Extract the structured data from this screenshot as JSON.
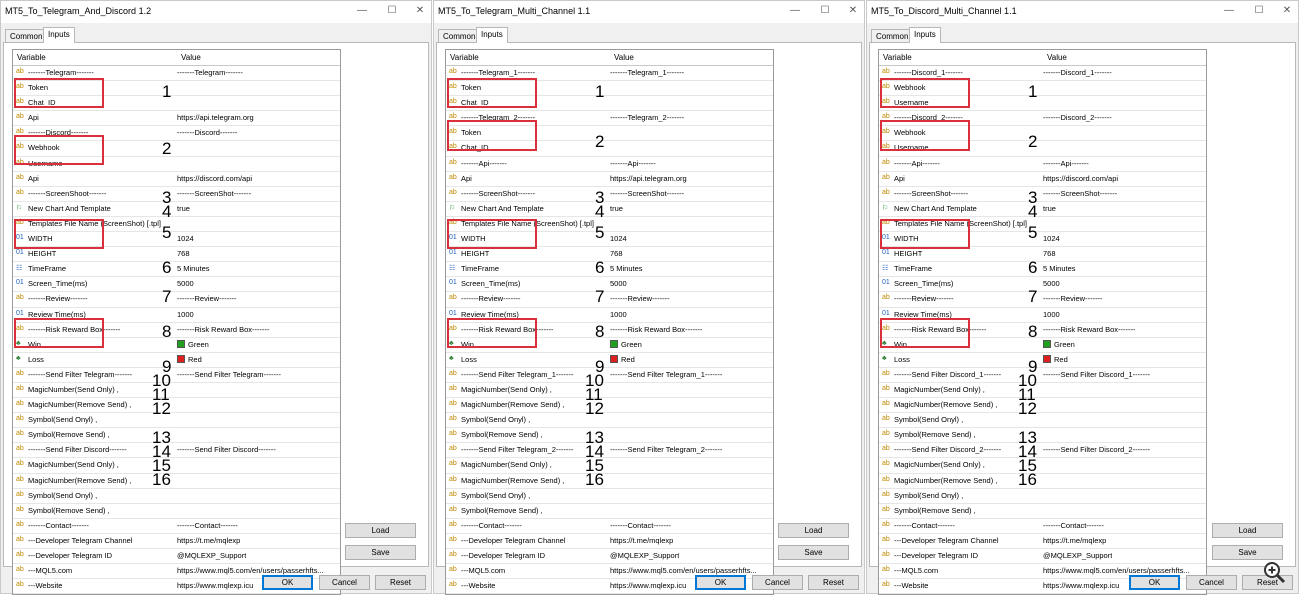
{
  "dialogs": [
    {
      "title": "MT5_To_Telegram_And_Discord 1.2",
      "tabs": [
        "Common",
        "Inputs"
      ],
      "active_tab": "Inputs",
      "columns": [
        "Variable",
        "Value"
      ],
      "rows": [
        {
          "icon": "ab",
          "name": "-------Telegram-------",
          "value": "-------Telegram-------"
        },
        {
          "icon": "ab",
          "name": "Token",
          "value": ""
        },
        {
          "icon": "ab",
          "name": "Chat_ID",
          "value": ""
        },
        {
          "icon": "ab",
          "name": "Api",
          "value": "https://api.telegram.org"
        },
        {
          "icon": "ab",
          "name": "-------Discord-------",
          "value": "-------Discord-------"
        },
        {
          "icon": "ab",
          "name": "Webhook",
          "value": ""
        },
        {
          "icon": "ab",
          "name": "Username",
          "value": ""
        },
        {
          "icon": "ab",
          "name": "Api",
          "value": "https://discord.com/api"
        },
        {
          "icon": "ab",
          "name": "-------ScreenShoot-------",
          "value": "-------ScreenShot-------"
        },
        {
          "icon": "bool",
          "name": "New Chart And Template",
          "value": "true"
        },
        {
          "icon": "ab",
          "name": "Templates File Name (ScreenShot) [.tpl]",
          "value": ""
        },
        {
          "icon": "01",
          "name": "WIDTH",
          "value": "1024"
        },
        {
          "icon": "01",
          "name": "HEIGHT",
          "value": "768"
        },
        {
          "icon": "tf",
          "name": "TimeFrame",
          "value": "5 Minutes"
        },
        {
          "icon": "01",
          "name": "Screen_Time(ms)",
          "value": "5000"
        },
        {
          "icon": "ab",
          "name": "-------Review-------",
          "value": "-------Review-------"
        },
        {
          "icon": "01",
          "name": "Review Time(ms)",
          "value": "1000"
        },
        {
          "icon": "ab",
          "name": "-------Risk Reward Box-------",
          "value": "-------Risk Reward Box-------"
        },
        {
          "icon": "clr",
          "name": "Win",
          "value": "Green",
          "color": "#1f9e1f"
        },
        {
          "icon": "clr",
          "name": "Loss",
          "value": "Red",
          "color": "#e0201e"
        },
        {
          "icon": "ab",
          "name": "-------Send Filter Telegram-------",
          "value": "-------Send Filter Telegram-------"
        },
        {
          "icon": "ab",
          "name": "MagicNumber(Send Only) ,",
          "value": ""
        },
        {
          "icon": "ab",
          "name": "MagicNumber(Remove Send) ,",
          "value": ""
        },
        {
          "icon": "ab",
          "name": "Symbol(Send Onyl) ,",
          "value": ""
        },
        {
          "icon": "ab",
          "name": "Symbol(Remove Send) ,",
          "value": ""
        },
        {
          "icon": "ab",
          "name": "-------Send Filter Discord-------",
          "value": "-------Send Filter Discord-------"
        },
        {
          "icon": "ab",
          "name": "MagicNumber(Send Only) ,",
          "value": ""
        },
        {
          "icon": "ab",
          "name": "MagicNumber(Remove Send) ,",
          "value": ""
        },
        {
          "icon": "ab",
          "name": "Symbol(Send Onyl) ,",
          "value": ""
        },
        {
          "icon": "ab",
          "name": "Symbol(Remove Send) ,",
          "value": ""
        },
        {
          "icon": "ab",
          "name": "-------Contact-------",
          "value": "-------Contact-------"
        },
        {
          "icon": "ab",
          "name": "---Developer Telegram Channel",
          "value": "https://t.me/mqlexp"
        },
        {
          "icon": "ab",
          "name": "---Developer Telegram ID",
          "value": "@MQLEXP_Support"
        },
        {
          "icon": "ab",
          "name": "---MQL5.com",
          "value": "https://www.mql5.com/en/users/passerhfts..."
        },
        {
          "icon": "ab",
          "name": "---Website",
          "value": "https://www.mqlexp.icu"
        }
      ],
      "annotations": [
        {
          "label": "1",
          "row": 1.5
        },
        {
          "label": "2",
          "row": 5.5
        },
        {
          "label": "3",
          "row": 9
        },
        {
          "label": "4",
          "row": 10
        },
        {
          "label": "5",
          "row": 11.5
        },
        {
          "label": "6",
          "row": 14
        },
        {
          "label": "7",
          "row": 16
        },
        {
          "label": "8",
          "row": 18.5
        },
        {
          "label": "9",
          "row": 21
        },
        {
          "label": "10",
          "row": 22
        },
        {
          "label": "11",
          "row": 23
        },
        {
          "label": "12",
          "row": 24
        },
        {
          "label": "13",
          "row": 26
        },
        {
          "label": "14",
          "row": 27
        },
        {
          "label": "15",
          "row": 28
        },
        {
          "label": "16",
          "row": 29
        }
      ],
      "boxes": [
        [
          1,
          2
        ],
        [
          5,
          6
        ],
        [
          11,
          12
        ],
        [
          18,
          19
        ]
      ],
      "side_buttons": {
        "load": "Load",
        "save": "Save"
      },
      "footer": {
        "ok": "OK",
        "cancel": "Cancel",
        "reset": "Reset"
      }
    },
    {
      "title": "MT5_To_Telegram_Multi_Channel 1.1",
      "tabs": [
        "Common",
        "Inputs"
      ],
      "active_tab": "Inputs",
      "columns": [
        "Variable",
        "Value"
      ],
      "rows": [
        {
          "icon": "ab",
          "name": "-------Telegram_1-------",
          "value": "-------Telegram_1-------"
        },
        {
          "icon": "ab",
          "name": "Token",
          "value": ""
        },
        {
          "icon": "ab",
          "name": "Chat_ID",
          "value": ""
        },
        {
          "icon": "ab",
          "name": "-------Telegram_2-------",
          "value": "-------Telegram_2-------"
        },
        {
          "icon": "ab",
          "name": "Token",
          "value": ""
        },
        {
          "icon": "ab",
          "name": "Chat_ID",
          "value": ""
        },
        {
          "icon": "ab",
          "name": "-------Api-------",
          "value": "-------Api-------"
        },
        {
          "icon": "ab",
          "name": "Api",
          "value": "https://api.telegram.org"
        },
        {
          "icon": "ab",
          "name": "-------ScreenShot-------",
          "value": "-------ScreenShot-------"
        },
        {
          "icon": "bool",
          "name": "New Chart And Template",
          "value": "true"
        },
        {
          "icon": "ab",
          "name": "Templates File Name (ScreenShot) [.tpl]",
          "value": ""
        },
        {
          "icon": "01",
          "name": "WIDTH",
          "value": "1024"
        },
        {
          "icon": "01",
          "name": "HEIGHT",
          "value": "768"
        },
        {
          "icon": "tf",
          "name": "TimeFrame",
          "value": "5 Minutes"
        },
        {
          "icon": "01",
          "name": "Screen_Time(ms)",
          "value": "5000"
        },
        {
          "icon": "ab",
          "name": "-------Review-------",
          "value": "-------Review-------"
        },
        {
          "icon": "01",
          "name": "Review Time(ms)",
          "value": "1000"
        },
        {
          "icon": "ab",
          "name": "-------Risk Reward Box-------",
          "value": "-------Risk Reward Box-------"
        },
        {
          "icon": "clr",
          "name": "Win",
          "value": "Green",
          "color": "#1f9e1f"
        },
        {
          "icon": "clr",
          "name": "Loss",
          "value": "Red",
          "color": "#e0201e"
        },
        {
          "icon": "ab",
          "name": "-------Send Filter Telegram_1-------",
          "value": "-------Send Filter Telegram_1-------"
        },
        {
          "icon": "ab",
          "name": "MagicNumber(Send Only) ,",
          "value": ""
        },
        {
          "icon": "ab",
          "name": "MagicNumber(Remove Send) ,",
          "value": ""
        },
        {
          "icon": "ab",
          "name": "Symbol(Send Onyl) ,",
          "value": ""
        },
        {
          "icon": "ab",
          "name": "Symbol(Remove Send) ,",
          "value": ""
        },
        {
          "icon": "ab",
          "name": "-------Send Filter Telegram_2-------",
          "value": "-------Send Filter Telegram_2-------"
        },
        {
          "icon": "ab",
          "name": "MagicNumber(Send Only) ,",
          "value": ""
        },
        {
          "icon": "ab",
          "name": "MagicNumber(Remove Send) ,",
          "value": ""
        },
        {
          "icon": "ab",
          "name": "Symbol(Send Onyl) ,",
          "value": ""
        },
        {
          "icon": "ab",
          "name": "Symbol(Remove Send) ,",
          "value": ""
        },
        {
          "icon": "ab",
          "name": "-------Contact-------",
          "value": "-------Contact-------"
        },
        {
          "icon": "ab",
          "name": "---Developer Telegram Channel",
          "value": "https://t.me/mqlexp"
        },
        {
          "icon": "ab",
          "name": "---Developer Telegram ID",
          "value": "@MQLEXP_Support"
        },
        {
          "icon": "ab",
          "name": "---MQL5.com",
          "value": "https://www.mql5.com/en/users/passerhfts..."
        },
        {
          "icon": "ab",
          "name": "---Website",
          "value": "https://www.mqlexp.icu"
        }
      ],
      "annotations": [
        {
          "label": "1",
          "row": 1.5
        },
        {
          "label": "2",
          "row": 5
        },
        {
          "label": "3",
          "row": 9
        },
        {
          "label": "4",
          "row": 10
        },
        {
          "label": "5",
          "row": 11.5
        },
        {
          "label": "6",
          "row": 14
        },
        {
          "label": "7",
          "row": 16
        },
        {
          "label": "8",
          "row": 18.5
        },
        {
          "label": "9",
          "row": 21
        },
        {
          "label": "10",
          "row": 22
        },
        {
          "label": "11",
          "row": 23
        },
        {
          "label": "12",
          "row": 24
        },
        {
          "label": "13",
          "row": 26
        },
        {
          "label": "14",
          "row": 27
        },
        {
          "label": "15",
          "row": 28
        },
        {
          "label": "16",
          "row": 29
        }
      ],
      "boxes": [
        [
          1,
          2
        ],
        [
          4,
          5
        ],
        [
          11,
          12
        ],
        [
          18,
          19
        ]
      ],
      "side_buttons": {
        "load": "Load",
        "save": "Save"
      },
      "footer": {
        "ok": "OK",
        "cancel": "Cancel",
        "reset": "Reset"
      }
    },
    {
      "title": "MT5_To_Discord_Multi_Channel 1.1",
      "tabs": [
        "Common",
        "Inputs"
      ],
      "active_tab": "Inputs",
      "columns": [
        "Variable",
        "Value"
      ],
      "rows": [
        {
          "icon": "ab",
          "name": "-------Discord_1-------",
          "value": "-------Discord_1-------"
        },
        {
          "icon": "ab",
          "name": "Webhook",
          "value": ""
        },
        {
          "icon": "ab",
          "name": "Username",
          "value": ""
        },
        {
          "icon": "ab",
          "name": "-------Discord_2-------",
          "value": "-------Discord_2-------"
        },
        {
          "icon": "ab",
          "name": "Webhook",
          "value": ""
        },
        {
          "icon": "ab",
          "name": "Username",
          "value": ""
        },
        {
          "icon": "ab",
          "name": "-------Api-------",
          "value": "-------Api-------"
        },
        {
          "icon": "ab",
          "name": "Api",
          "value": "https://discord.com/api"
        },
        {
          "icon": "ab",
          "name": "-------ScreenShot-------",
          "value": "-------ScreenShot-------"
        },
        {
          "icon": "bool",
          "name": "New Chart And Template",
          "value": "true"
        },
        {
          "icon": "ab",
          "name": "Templates File Name (ScreenShot) [.tpl]",
          "value": ""
        },
        {
          "icon": "01",
          "name": "WIDTH",
          "value": "1024"
        },
        {
          "icon": "01",
          "name": "HEIGHT",
          "value": "768"
        },
        {
          "icon": "tf",
          "name": "TimeFrame",
          "value": "5 Minutes"
        },
        {
          "icon": "01",
          "name": "Screen_Time(ms)",
          "value": "5000"
        },
        {
          "icon": "ab",
          "name": "-------Review-------",
          "value": "-------Review-------"
        },
        {
          "icon": "01",
          "name": "Review Time(ms)",
          "value": "1000"
        },
        {
          "icon": "ab",
          "name": "-------Risk Reward Box-------",
          "value": "-------Risk Reward Box-------"
        },
        {
          "icon": "clr",
          "name": "Win",
          "value": "Green",
          "color": "#1f9e1f"
        },
        {
          "icon": "clr",
          "name": "Loss",
          "value": "Red",
          "color": "#e0201e"
        },
        {
          "icon": "ab",
          "name": "-------Send Filter Discord_1-------",
          "value": "-------Send Filter Discord_1-------"
        },
        {
          "icon": "ab",
          "name": "MagicNumber(Send Only) ,",
          "value": ""
        },
        {
          "icon": "ab",
          "name": "MagicNumber(Remove Send) ,",
          "value": ""
        },
        {
          "icon": "ab",
          "name": "Symbol(Send Onyl) ,",
          "value": ""
        },
        {
          "icon": "ab",
          "name": "Symbol(Remove Send) ,",
          "value": ""
        },
        {
          "icon": "ab",
          "name": "-------Send Filter Discord_2-------",
          "value": "-------Send Filter Discord_2-------"
        },
        {
          "icon": "ab",
          "name": "MagicNumber(Send Only) ,",
          "value": ""
        },
        {
          "icon": "ab",
          "name": "MagicNumber(Remove Send) ,",
          "value": ""
        },
        {
          "icon": "ab",
          "name": "Symbol(Send Onyl) ,",
          "value": ""
        },
        {
          "icon": "ab",
          "name": "Symbol(Remove Send) ,",
          "value": ""
        },
        {
          "icon": "ab",
          "name": "-------Contact-------",
          "value": "-------Contact-------"
        },
        {
          "icon": "ab",
          "name": "---Developer Telegram Channel",
          "value": "https://t.me/mqlexp"
        },
        {
          "icon": "ab",
          "name": "---Developer Telegram ID",
          "value": "@MQLEXP_Support"
        },
        {
          "icon": "ab",
          "name": "---MQL5.com",
          "value": "https://www.mql5.com/en/users/passerhfts..."
        },
        {
          "icon": "ab",
          "name": "---Website",
          "value": "https://www.mqlexp.icu"
        }
      ],
      "annotations": [
        {
          "label": "1",
          "row": 1.5
        },
        {
          "label": "2",
          "row": 5
        },
        {
          "label": "3",
          "row": 9
        },
        {
          "label": "4",
          "row": 10
        },
        {
          "label": "5",
          "row": 11.5
        },
        {
          "label": "6",
          "row": 14
        },
        {
          "label": "7",
          "row": 16
        },
        {
          "label": "8",
          "row": 18.5
        },
        {
          "label": "9",
          "row": 21
        },
        {
          "label": "10",
          "row": 22
        },
        {
          "label": "11",
          "row": 23
        },
        {
          "label": "12",
          "row": 24
        },
        {
          "label": "13",
          "row": 26
        },
        {
          "label": "14",
          "row": 27
        },
        {
          "label": "15",
          "row": 28
        },
        {
          "label": "16",
          "row": 29
        }
      ],
      "boxes": [
        [
          1,
          2
        ],
        [
          4,
          5
        ],
        [
          11,
          12
        ],
        [
          18,
          19
        ]
      ],
      "side_buttons": {
        "load": "Load",
        "save": "Save"
      },
      "footer": {
        "ok": "OK",
        "cancel": "Cancel",
        "reset": "Reset"
      }
    }
  ],
  "window_controls": {
    "minimize": "—",
    "maximize": "☐",
    "close": "✕"
  },
  "icon_glyphs": {
    "ab": "ab",
    "01": "01",
    "bool": "⚐",
    "tf": "☷",
    "clr": "♣"
  },
  "colors": {
    "annotation_box": "#d9303b",
    "ok_border": "#0078d7"
  },
  "magnifier_icon": "zoom-in-icon"
}
